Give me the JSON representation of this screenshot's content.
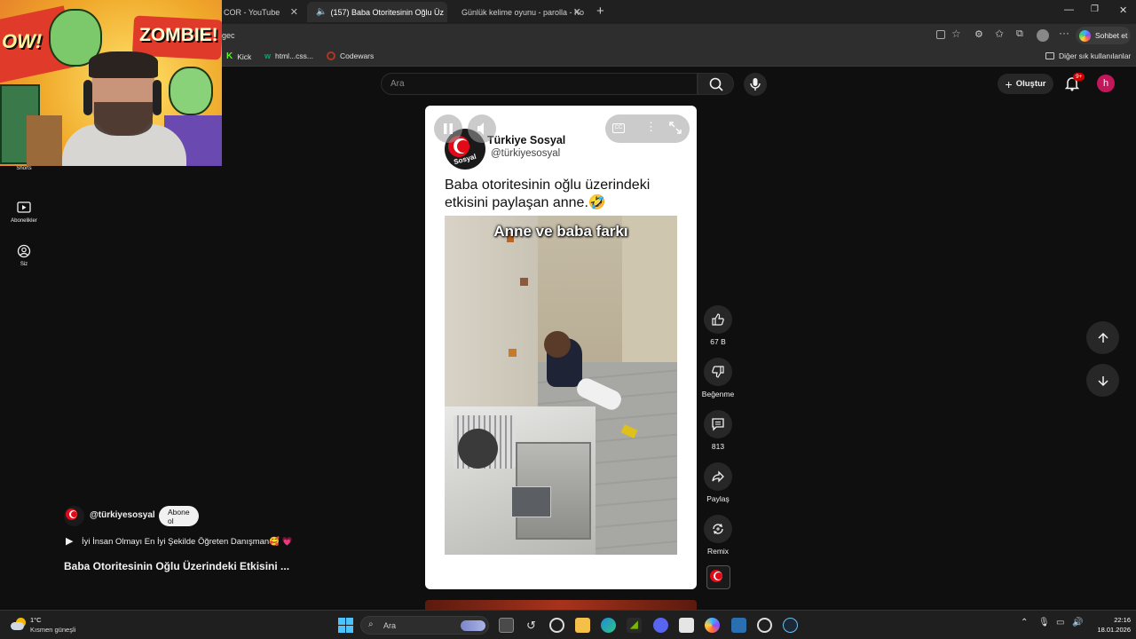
{
  "browser": {
    "tabs": [
      {
        "title": "COR - YouTube"
      },
      {
        "title": "(157) Baba Otoritesinin Oğlu Üz"
      },
      {
        "title": "Günlük kelime oyunu - parolla - Ko"
      }
    ],
    "address": "gec",
    "chat_label": "Sohbet et",
    "bookmarks": [
      {
        "label": "Kick"
      },
      {
        "label": "html...css..."
      },
      {
        "label": "Codewars"
      }
    ],
    "other_bookmarks": "Diğer sık kullanılanlar"
  },
  "youtube": {
    "search_placeholder": "Ara",
    "create_label": "Oluştur",
    "notification_badge": "9+",
    "avatar_letter": "h",
    "sidebar": [
      {
        "label": "Shorts"
      },
      {
        "label": "Abonelikler"
      },
      {
        "label": "Siz"
      }
    ],
    "short": {
      "channel_name": "Türkiye Sosyal",
      "channel_handle": "@türkiyesosyal",
      "logo_text": "Sosyal",
      "caption": "Baba otoritesinin oğlu üzerindeki etkisini paylaşan anne.🤣",
      "overlay_text": "Anne ve baba farkı"
    },
    "actions": {
      "like_count": "67 B",
      "dislike_label": "Beğenme",
      "comment_count": "813",
      "share_label": "Paylaş",
      "remix_label": "Remix"
    },
    "meta": {
      "channel_handle": "@türkiyesosyal",
      "subscribe_label": "Abone ol",
      "playlist_text": "İyi İnsan Olmayı En İyi Şekilde Öğreten Danışman🥰 💗",
      "video_title": "Baba Otoritesinin Oğlu Üzerindeki Etkisini ..."
    }
  },
  "webcam": {
    "comic_word_1": "OW!",
    "comic_word_2": "ZOMBIE!"
  },
  "taskbar": {
    "weather_temp": "1°C",
    "weather_desc": "Kısmen güneşli",
    "search_label": "Ara",
    "time": "22:16",
    "date": "18.01.2026"
  }
}
